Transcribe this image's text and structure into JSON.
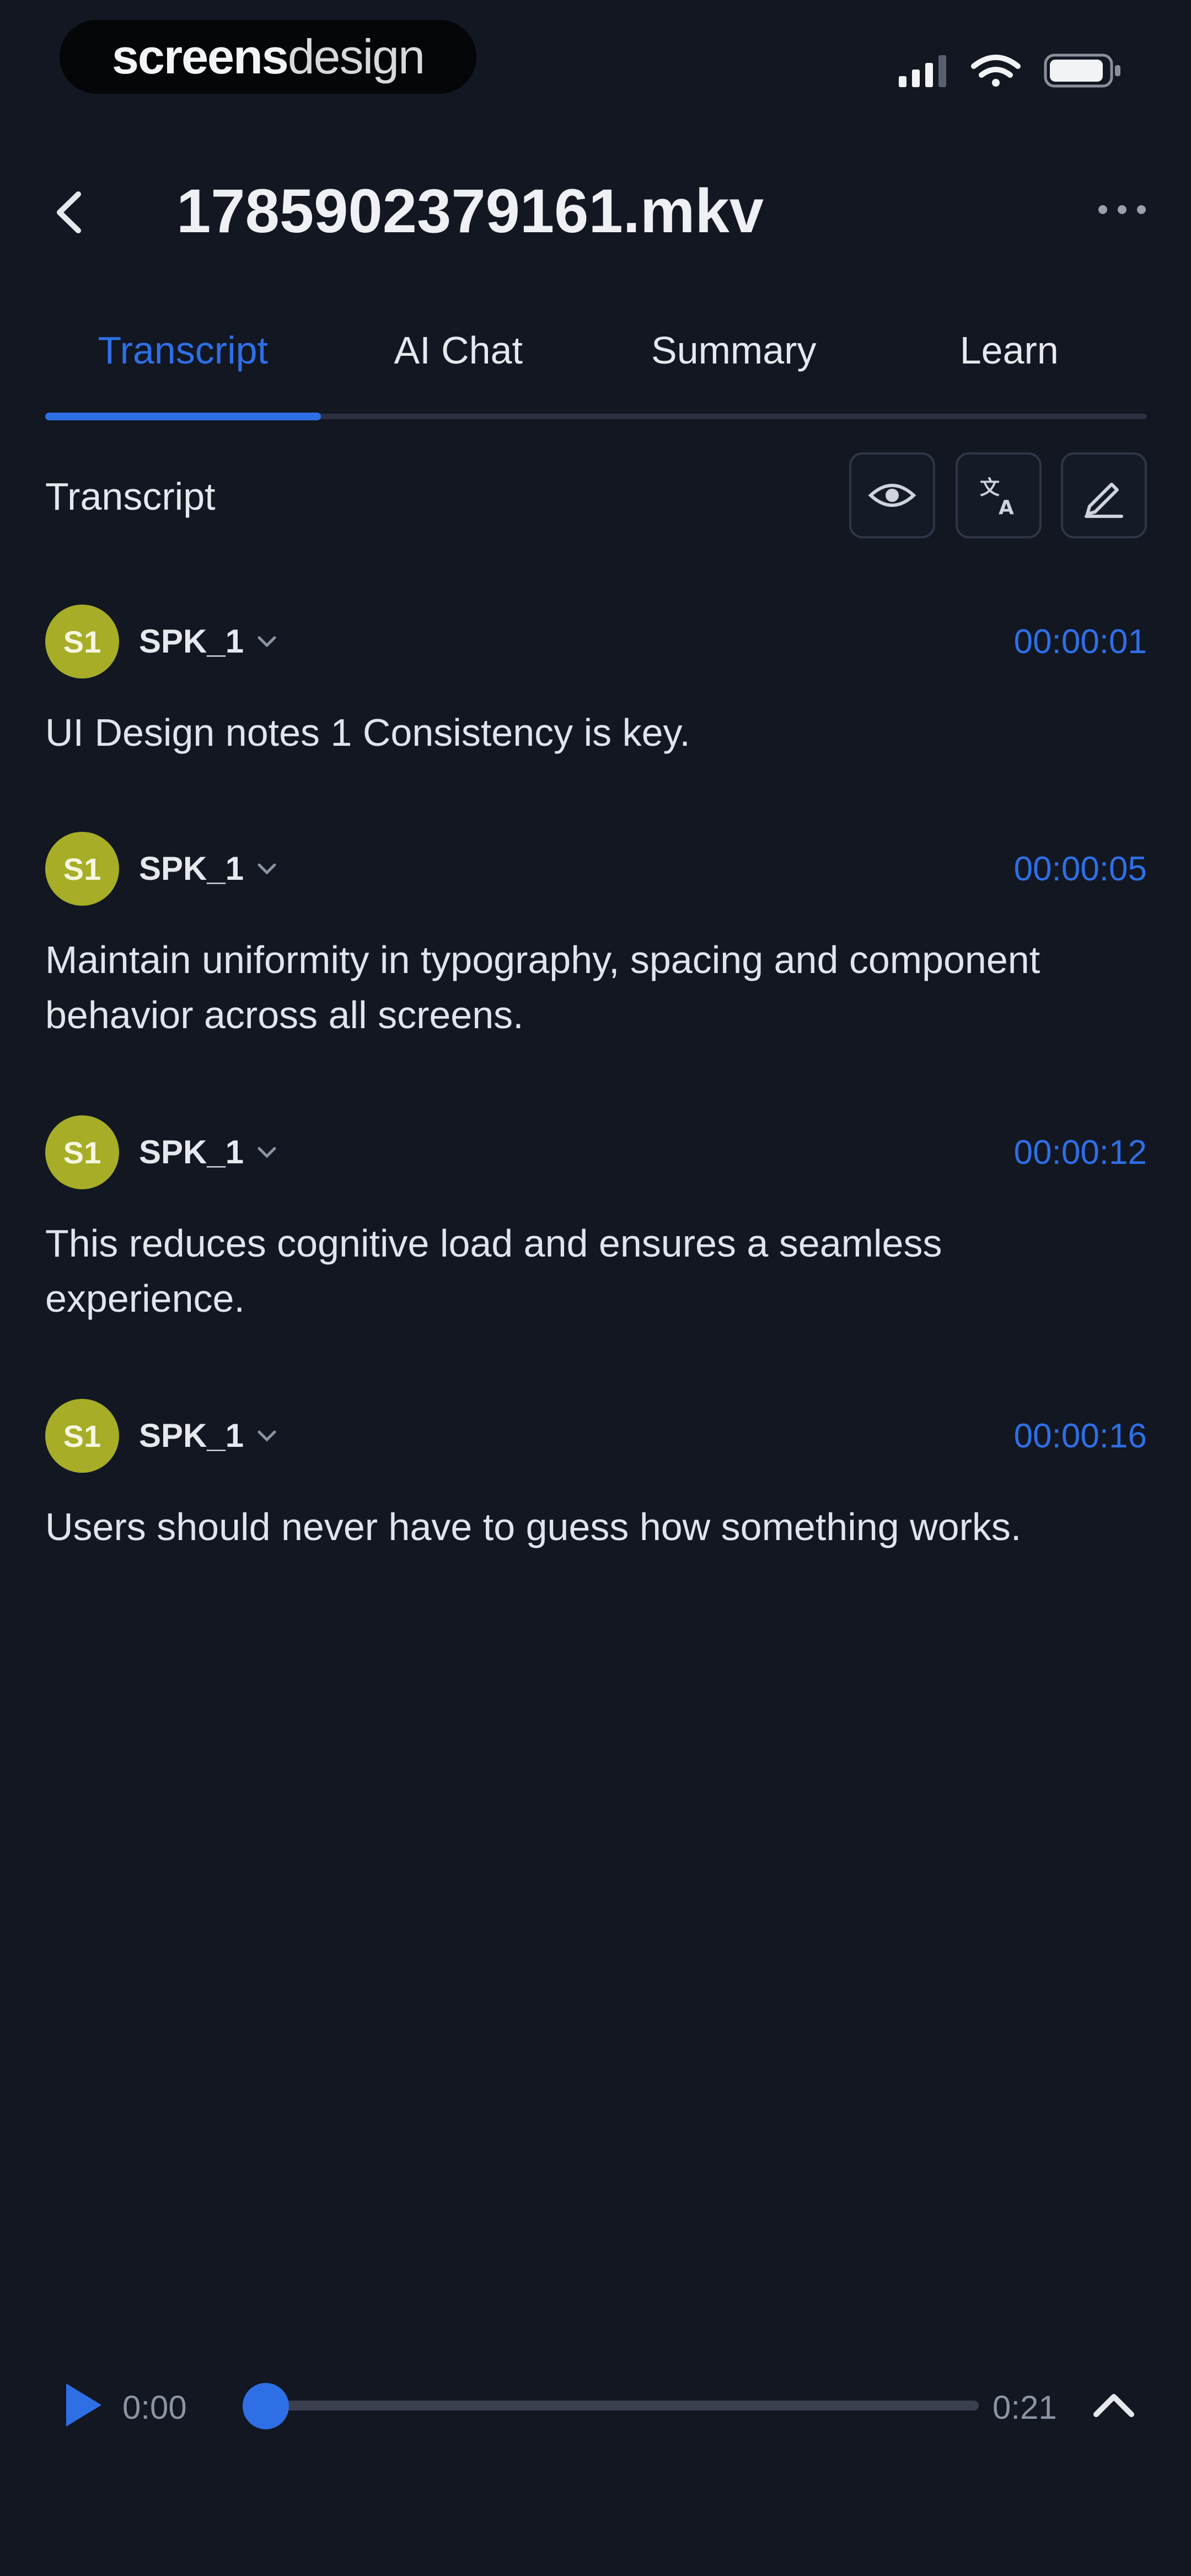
{
  "status_bar": {
    "brand_bold": "screens",
    "brand_light": "design"
  },
  "header": {
    "title": "1785902379161.mkv",
    "back_icon": "chevron-left-icon",
    "more_icon": "more-horizontal-icon"
  },
  "tabs": [
    {
      "label": "Transcript",
      "active": true
    },
    {
      "label": "AI Chat",
      "active": false
    },
    {
      "label": "Summary",
      "active": false
    },
    {
      "label": "Learn",
      "active": false
    }
  ],
  "section": {
    "title": "Transcript",
    "tools": [
      "eye-icon",
      "translate-icon",
      "edit-icon"
    ]
  },
  "entries": [
    {
      "avatar": "S1",
      "speaker": "SPK_1",
      "time": "00:00:01",
      "text": "UI Design notes 1 Consistency is key."
    },
    {
      "avatar": "S1",
      "speaker": "SPK_1",
      "time": "00:00:05",
      "text": "Maintain uniformity in typography, spacing and component behavior across all screens."
    },
    {
      "avatar": "S1",
      "speaker": "SPK_1",
      "time": "00:00:12",
      "text": "This reduces cognitive load and ensures a seamless experience."
    },
    {
      "avatar": "S1",
      "speaker": "SPK_1",
      "time": "00:00:16",
      "text": "Users should never have to guess how something works."
    }
  ],
  "player": {
    "current": "0:00",
    "total": "0:21",
    "progress": 0
  },
  "colors": {
    "background": "#121722",
    "accent": "#2f6fe6",
    "avatar": "#a7ad26"
  }
}
